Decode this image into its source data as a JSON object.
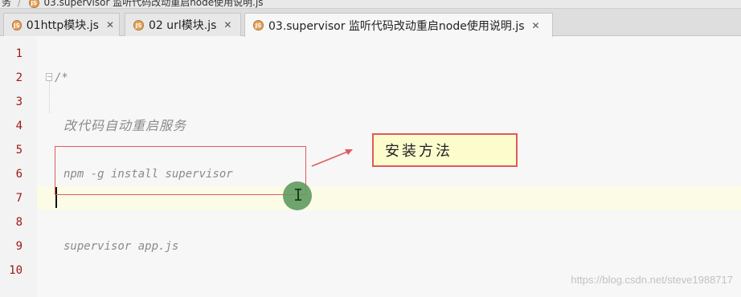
{
  "breadcrumb": {
    "parent": "务",
    "file": "03.supervisor 监听代码改动重启node使用说明.js"
  },
  "tabs": [
    {
      "icon": "JS",
      "label": "01http模块.js",
      "close": "✕",
      "active": false
    },
    {
      "icon": "JS",
      "label": "02 url模块.js",
      "close": "✕",
      "active": false
    },
    {
      "icon": "JS",
      "label": "03.supervisor 监听代码改动重启node使用说明.js",
      "close": "✕",
      "active": true
    }
  ],
  "editor": {
    "line_numbers": [
      "1",
      "2",
      "3",
      "4",
      "5",
      "6",
      "7",
      "8",
      "9",
      "10"
    ],
    "lines": {
      "2": "/*",
      "4": "改代码自动重启服务",
      "6": "npm -g install supervisor",
      "9": "supervisor app.js"
    },
    "current_line": 7
  },
  "annotation": {
    "callout_text": "安装方法",
    "accent_color": "#e05a5a",
    "callout_bg": "#fdfccd"
  },
  "watermark": "https://blog.csdn.net/steve1988717"
}
